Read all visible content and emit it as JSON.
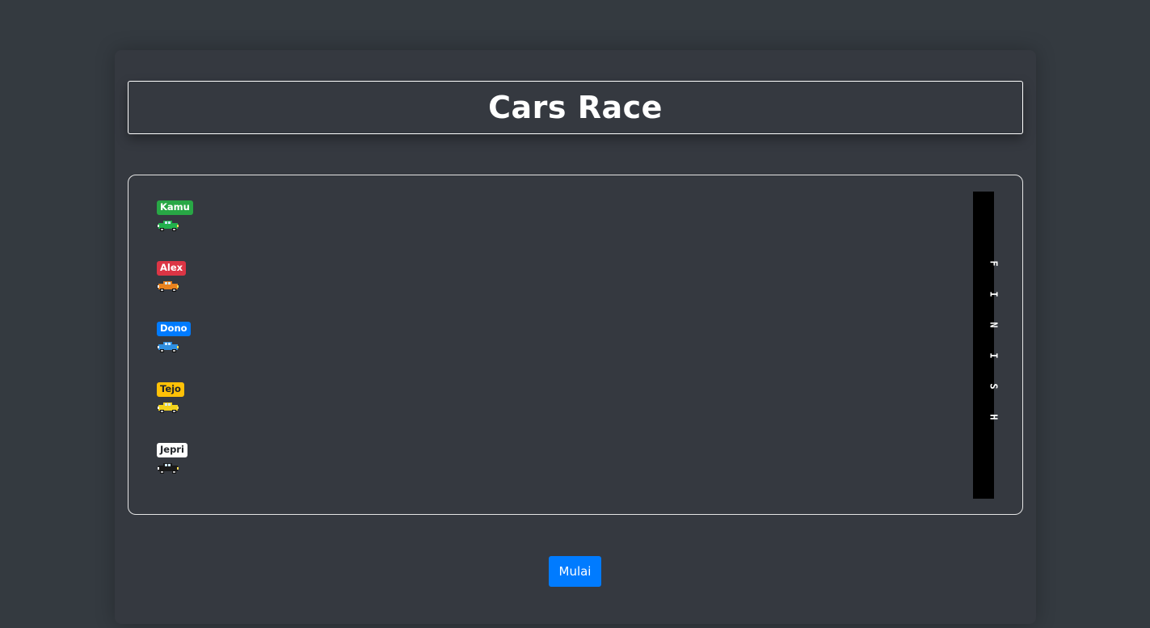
{
  "title": "Cars Race",
  "racers": [
    {
      "name": "Kamu",
      "badge_bg": "#28a745",
      "badge_fg": "#ffffff",
      "car_color": "#22b14c",
      "progress": 0
    },
    {
      "name": "Alex",
      "badge_bg": "#dc3545",
      "badge_fg": "#ffffff",
      "car_color": "#e8821e",
      "progress": 0
    },
    {
      "name": "Dono",
      "badge_bg": "#007bff",
      "badge_fg": "#ffffff",
      "car_color": "#2f8fe0",
      "progress": 0
    },
    {
      "name": "Tejo",
      "badge_bg": "#ffc107",
      "badge_fg": "#212529",
      "car_color": "#f2d21b",
      "progress": 0
    },
    {
      "name": "Jepri",
      "badge_bg": "#ffffff",
      "badge_fg": "#212529",
      "car_color": "#1a1a1a",
      "progress": 0
    }
  ],
  "finish_letters": [
    "F",
    "I",
    "N",
    "I",
    "S",
    "H"
  ],
  "start_button": "Mulai"
}
